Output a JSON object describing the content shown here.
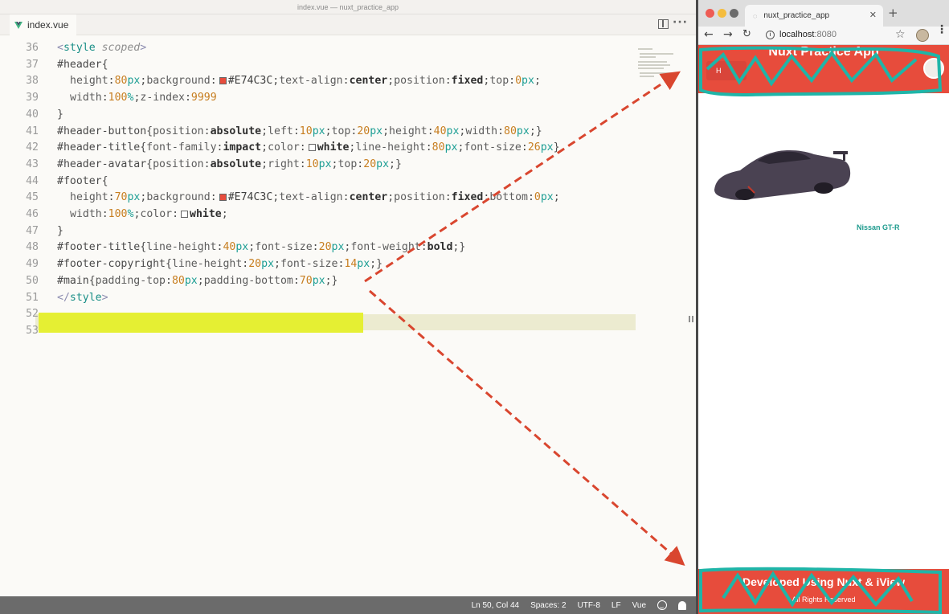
{
  "editor": {
    "window_title": "index.vue — nuxt_practice_app",
    "tab_label": "index.vue",
    "highlight_color": "#e5ef2a",
    "lines": [
      {
        "n": "36",
        "html": "<span class='t-tag'>&lt;</span><span class='t-tagname'>style</span> <span class='t-attr'>scoped</span><span class='t-tag'>&gt;</span>"
      },
      {
        "n": "37",
        "html": "<span class='t-sel'>#header</span>{"
      },
      {
        "n": "38",
        "html": "<span class='indent'><span class='t-prop'>height</span>:<span class='t-num'>80</span><span class='t-unit'>px</span>;<span class='t-prop'>background</span>:<span class='swatch red'></span><span class='t-hex'>#E74C3C</span>;<span class='t-prop'>text-align</span>:<span class='t-kw'>center</span>;<span class='t-prop'>position</span>:<span class='t-kw'>fixed</span>;<span class='t-prop'>top</span>:<span class='t-num'>0</span><span class='t-unit'>px</span>;</span>"
      },
      {
        "n": "39",
        "html": "<span class='indent'><span class='t-prop'>width</span>:<span class='t-num'>100</span><span class='t-unit'>%</span>;<span class='t-prop'>z-index</span>:<span class='t-num'>9999</span></span>"
      },
      {
        "n": "40",
        "html": "}"
      },
      {
        "n": "41",
        "html": "<span class='t-sel'>#header-button</span>{<span class='t-prop'>position</span>:<span class='t-kw'>absolute</span>;<span class='t-prop'>left</span>:<span class='t-num'>10</span><span class='t-unit'>px</span>;<span class='t-prop'>top</span>:<span class='t-num'>20</span><span class='t-unit'>px</span>;<span class='t-prop'>height</span>:<span class='t-num'>40</span><span class='t-unit'>px</span>;<span class='t-prop'>width</span>:<span class='t-num'>80</span><span class='t-unit'>px</span>;}"
      },
      {
        "n": "42",
        "html": "<span class='t-sel'>#header-title</span>{<span class='t-prop'>font-family</span>:<span class='t-kw'>impact</span>;<span class='t-prop'>color</span>:<span class='swatch white'></span><span class='t-kw'>white</span>;<span class='t-prop'>line-height</span>:<span class='t-num'>80</span><span class='t-unit'>px</span>;<span class='t-prop'>font-size</span>:<span class='t-num'>26</span><span class='t-unit'>px</span>}"
      },
      {
        "n": "43",
        "html": "<span class='t-sel'>#header-avatar</span>{<span class='t-prop'>position</span>:<span class='t-kw'>absolute</span>;<span class='t-prop'>right</span>:<span class='t-num'>10</span><span class='t-unit'>px</span>;<span class='t-prop'>top</span>:<span class='t-num'>20</span><span class='t-unit'>px</span>;}"
      },
      {
        "n": "44",
        "html": "<span class='t-sel'>#footer</span>{"
      },
      {
        "n": "45",
        "html": "<span class='indent'><span class='t-prop'>height</span>:<span class='t-num'>70</span><span class='t-unit'>px</span>;<span class='t-prop'>background</span>:<span class='swatch red'></span><span class='t-hex'>#E74C3C</span>;<span class='t-prop'>text-align</span>:<span class='t-kw'>center</span>;<span class='t-prop'>position</span>:<span class='t-kw'>fixed</span>;<span class='t-prop'>bottom</span>:<span class='t-num'>0</span><span class='t-unit'>px</span>;</span>"
      },
      {
        "n": "46",
        "html": "<span class='indent'><span class='t-prop'>width</span>:<span class='t-num'>100</span><span class='t-unit'>%</span>;<span class='t-prop'>color</span>:<span class='swatch white'></span><span class='t-kw'>white</span>;</span>"
      },
      {
        "n": "47",
        "html": "}"
      },
      {
        "n": "48",
        "html": "<span class='t-sel'>#footer-title</span>{<span class='t-prop'>line-height</span>:<span class='t-num'>40</span><span class='t-unit'>px</span>;<span class='t-prop'>font-size</span>:<span class='t-num'>20</span><span class='t-unit'>px</span>;<span class='t-prop'>font-weight</span>:<span class='t-kw'>bold</span>;}"
      },
      {
        "n": "49",
        "html": "<span class='t-sel'>#footer-copyright</span>{<span class='t-prop'>line-height</span>:<span class='t-num'>20</span><span class='t-unit'>px</span>;<span class='t-prop'>font-size</span>:<span class='t-num'>14</span><span class='t-unit'>px</span>;}"
      },
      {
        "n": "50",
        "html": "<span class='t-sel'>#main</span>{<span class='t-prop'>padding-top</span>:<span class='t-num'>80</span><span class='t-unit'>px</span>;<span class='t-prop'>padding-bottom</span>:<span class='t-num'>70</span><span class='t-unit'>px</span>;}"
      },
      {
        "n": "51",
        "html": "<span class='t-tag'>&lt;/</span><span class='t-tagname'>style</span><span class='t-tag'>&gt;</span>"
      },
      {
        "n": "52",
        "html": ""
      },
      {
        "n": "53",
        "html": ""
      }
    ],
    "status": {
      "position": "Ln 50, Col 44",
      "spaces": "Spaces: 2",
      "encoding": "UTF-8",
      "eol": "LF",
      "language": "Vue"
    }
  },
  "browser": {
    "tab_title": "nuxt_practice_app",
    "url_host": "localhost",
    "url_port": ":8080",
    "header_title": "Nuxt Practice App",
    "header_button": "H",
    "car_name": "Nissan GT-R",
    "footer_title": "Developed Using Nuxt & iView",
    "footer_copyright": "All Rights Reserved",
    "brand_color": "#e74c3c",
    "annotation_color": "#1fb5a8",
    "arrow_color": "#d9462f"
  }
}
